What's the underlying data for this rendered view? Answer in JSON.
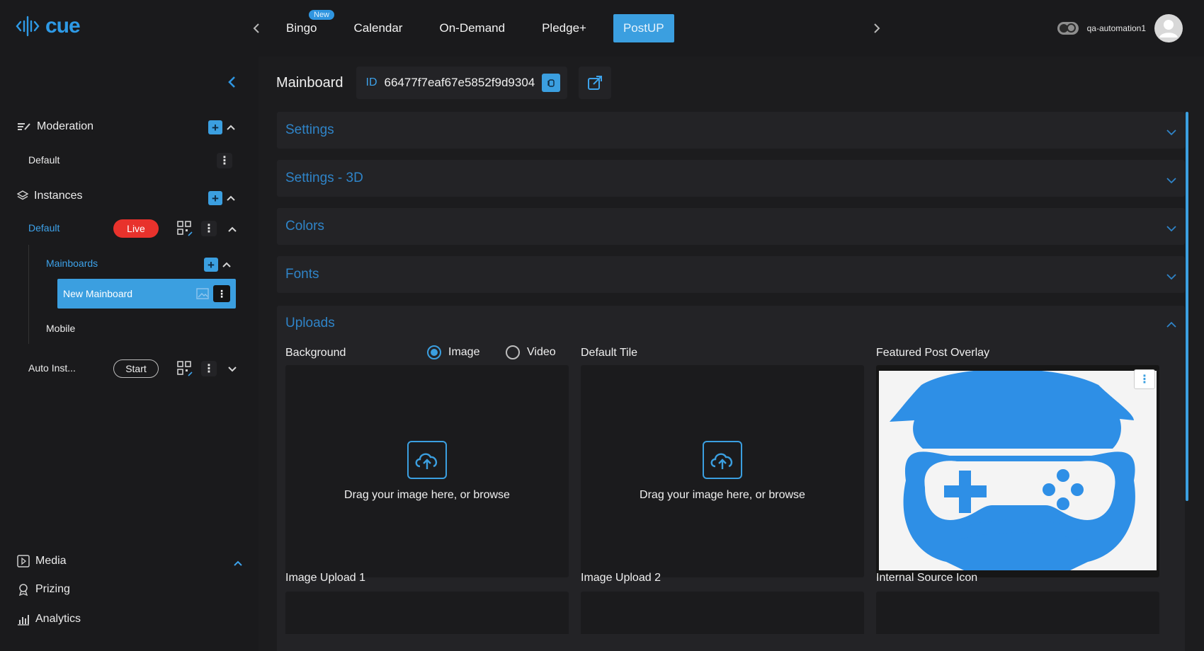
{
  "brand": {
    "name": "cue",
    "accent": "#3b9fe0"
  },
  "topnav": {
    "tabs": [
      {
        "label": "Bingo",
        "badge": "New"
      },
      {
        "label": "Calendar"
      },
      {
        "label": "On-Demand"
      },
      {
        "label": "Pledge+"
      },
      {
        "label": "PostUP",
        "active": true
      }
    ],
    "account": {
      "username": "qa-automation1"
    }
  },
  "sidebar": {
    "moderation": {
      "label": "Moderation",
      "items": [
        {
          "label": "Default"
        }
      ]
    },
    "instances": {
      "label": "Instances",
      "default": {
        "label": "Default",
        "status": "Live"
      },
      "mainboards": {
        "label": "Mainboards",
        "selected": "New Mainboard"
      },
      "mobile": {
        "label": "Mobile"
      },
      "auto": {
        "label": "Auto Inst...",
        "action": "Start"
      }
    },
    "bottom": [
      {
        "label": "Media"
      },
      {
        "label": "Prizing"
      },
      {
        "label": "Analytics"
      }
    ]
  },
  "main": {
    "title": "Mainboard",
    "id_label": "ID",
    "id_value": "66477f7eaf67e5852f9d9304",
    "sections": [
      {
        "label": "Settings"
      },
      {
        "label": "Settings - 3D"
      },
      {
        "label": "Colors"
      },
      {
        "label": "Fonts"
      }
    ],
    "uploads": {
      "label": "Uploads",
      "background": {
        "label": "Background",
        "options": [
          "Image",
          "Video"
        ],
        "selected": "Image",
        "dropzone_text": "Drag your image here, or browse"
      },
      "default_tile": {
        "label": "Default Tile",
        "dropzone_text": "Drag your image here, or browse"
      },
      "featured_overlay": {
        "label": "Featured Post Overlay"
      },
      "image_upload_1": {
        "label": "Image Upload 1"
      },
      "image_upload_2": {
        "label": "Image Upload 2"
      },
      "internal_source_icon": {
        "label": "Internal Source Icon"
      }
    }
  }
}
